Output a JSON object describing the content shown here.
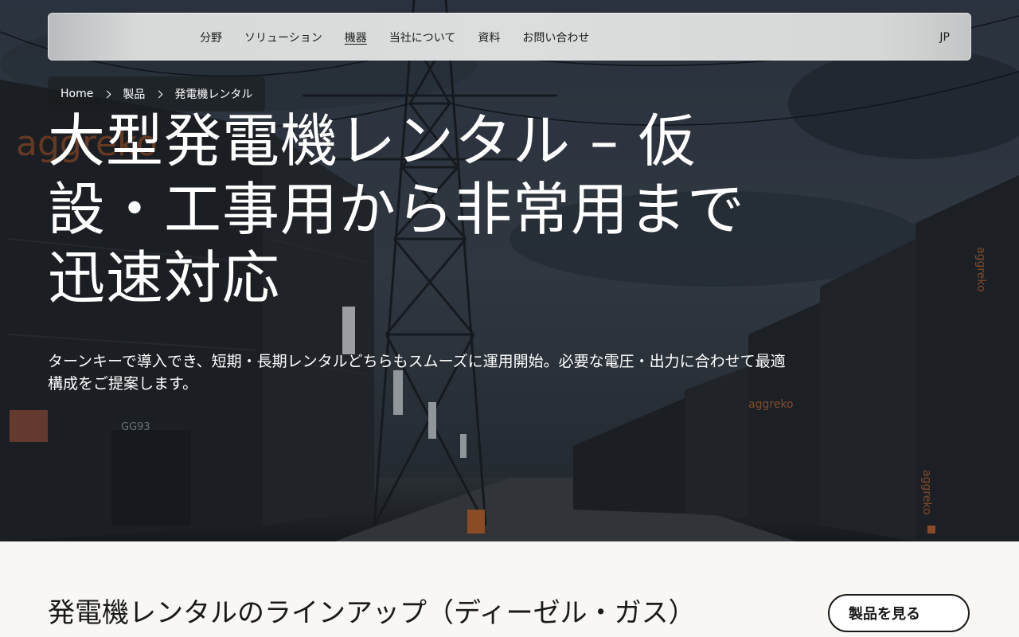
{
  "nav": {
    "links": [
      {
        "label": "分野"
      },
      {
        "label": "ソリューション"
      },
      {
        "label": "機器"
      },
      {
        "label": "当社について"
      },
      {
        "label": "資料"
      },
      {
        "label": "お問い合わせ"
      }
    ],
    "active_index": 2,
    "language": "JP"
  },
  "breadcrumb": {
    "items": [
      "Home",
      "製品",
      "発電機レンタル"
    ]
  },
  "hero": {
    "title": "大型発電機レンタル – 仮設・工事用から非常用まで迅速対応",
    "subtitle": "ターンキーで導入でき、短期・長期レンタルどちらもスムーズに運用開始。必要な電圧・出力に合わせて最適構成をご提案します。",
    "image_text": [
      "aggreko",
      "GG93",
      "aggreko",
      "aggreko",
      "aggreko"
    ]
  },
  "section": {
    "title": "発電機レンタルのラインアップ（ディーゼル・ガス）",
    "cta_label": "製品を見る"
  }
}
